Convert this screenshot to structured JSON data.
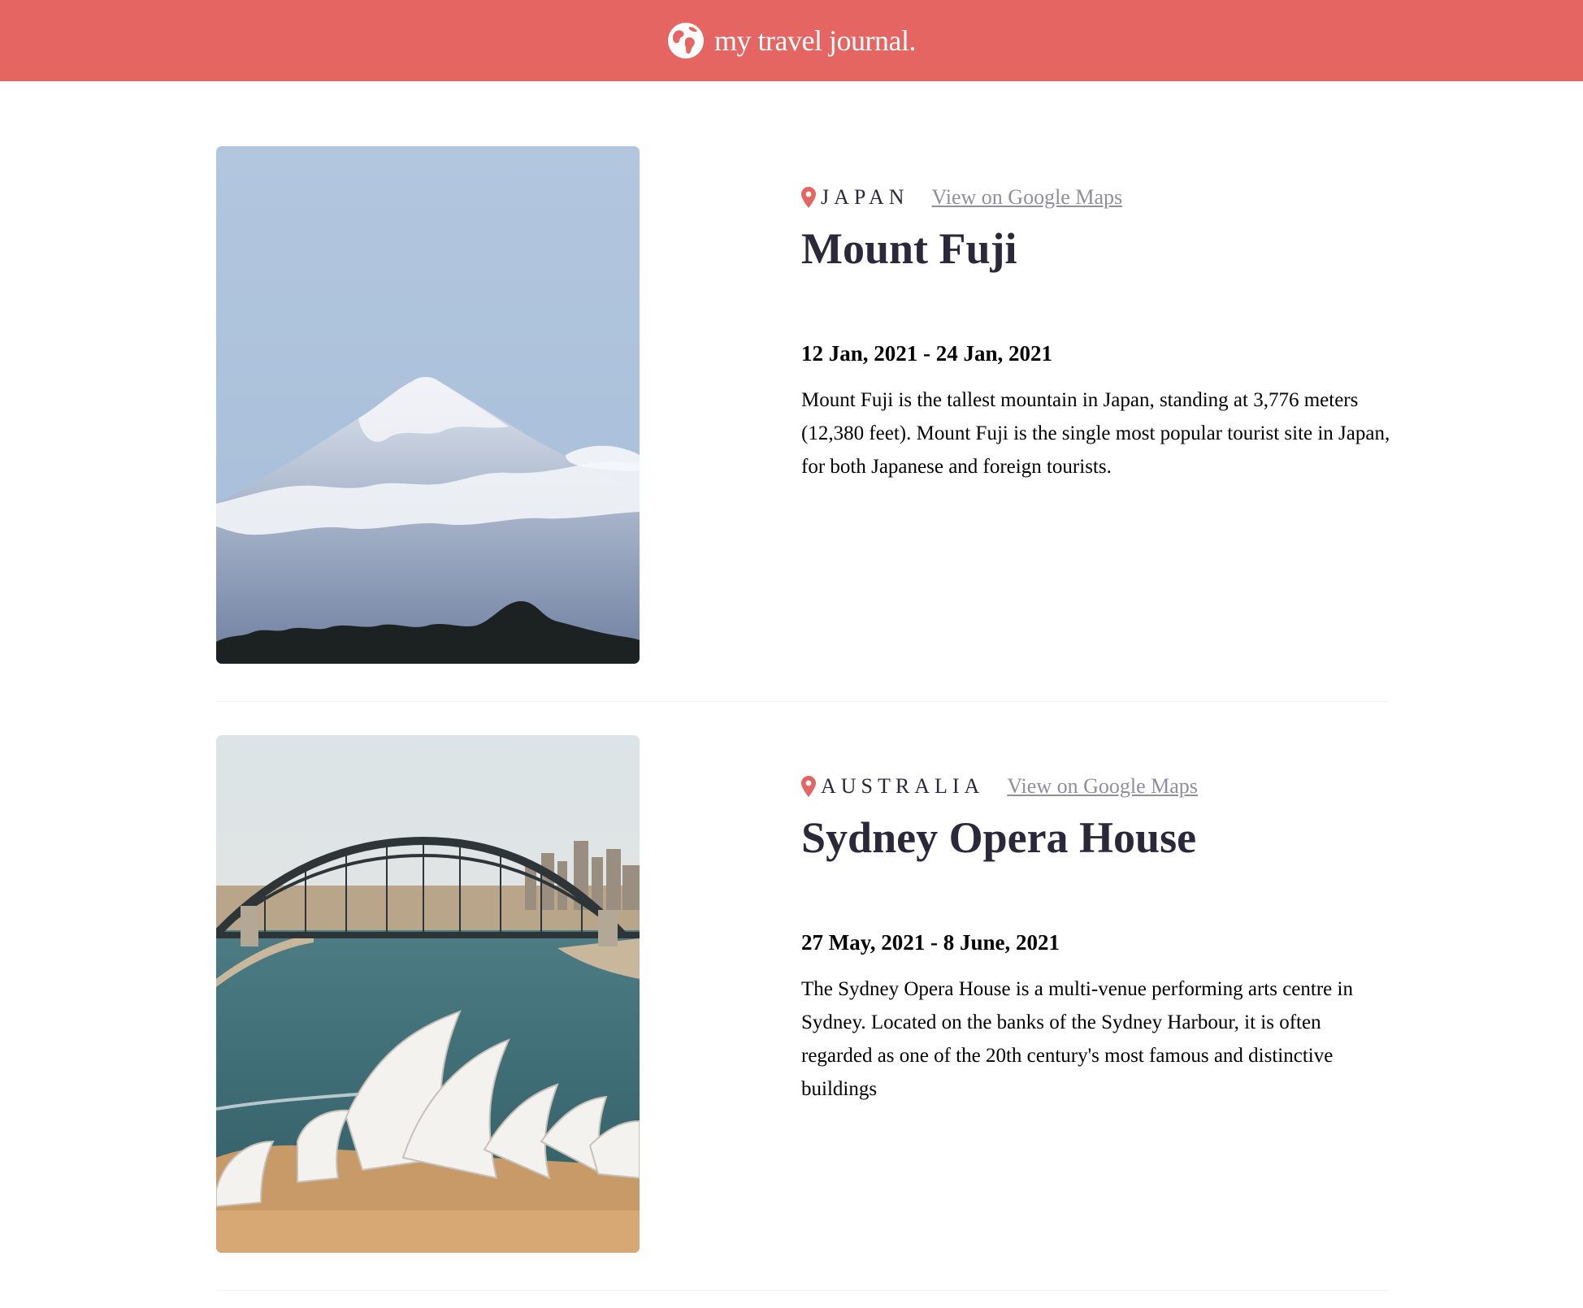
{
  "header": {
    "brand": "my travel journal.",
    "brand_icon": "globe-icon",
    "background": "#e46562"
  },
  "entries": [
    {
      "country": "JAPAN",
      "maps_label": "View on Google Maps",
      "title": "Mount Fuji",
      "dates": "12 Jan, 2021 - 24 Jan, 2021",
      "description": "Mount Fuji is the tallest mountain in Japan, standing at 3,776 meters (12,380 feet). Mount Fuji is the single most popular tourist site in Japan, for both Japanese and foreign tourists.",
      "photo_icon": "mount-fuji-photo"
    },
    {
      "country": "AUSTRALIA",
      "maps_label": "View on Google Maps",
      "title": "Sydney Opera House",
      "dates": "27 May, 2021 - 8 June, 2021",
      "description": "The Sydney Opera House is a multi-venue performing arts centre in Sydney. Located on the banks of the Sydney Harbour, it is often regarded as one of the 20th century's most famous and distinctive buildings",
      "photo_icon": "sydney-opera-house-photo"
    }
  ],
  "colors": {
    "accent": "#e46562",
    "title": "#2b283a",
    "link": "#918e9b"
  }
}
